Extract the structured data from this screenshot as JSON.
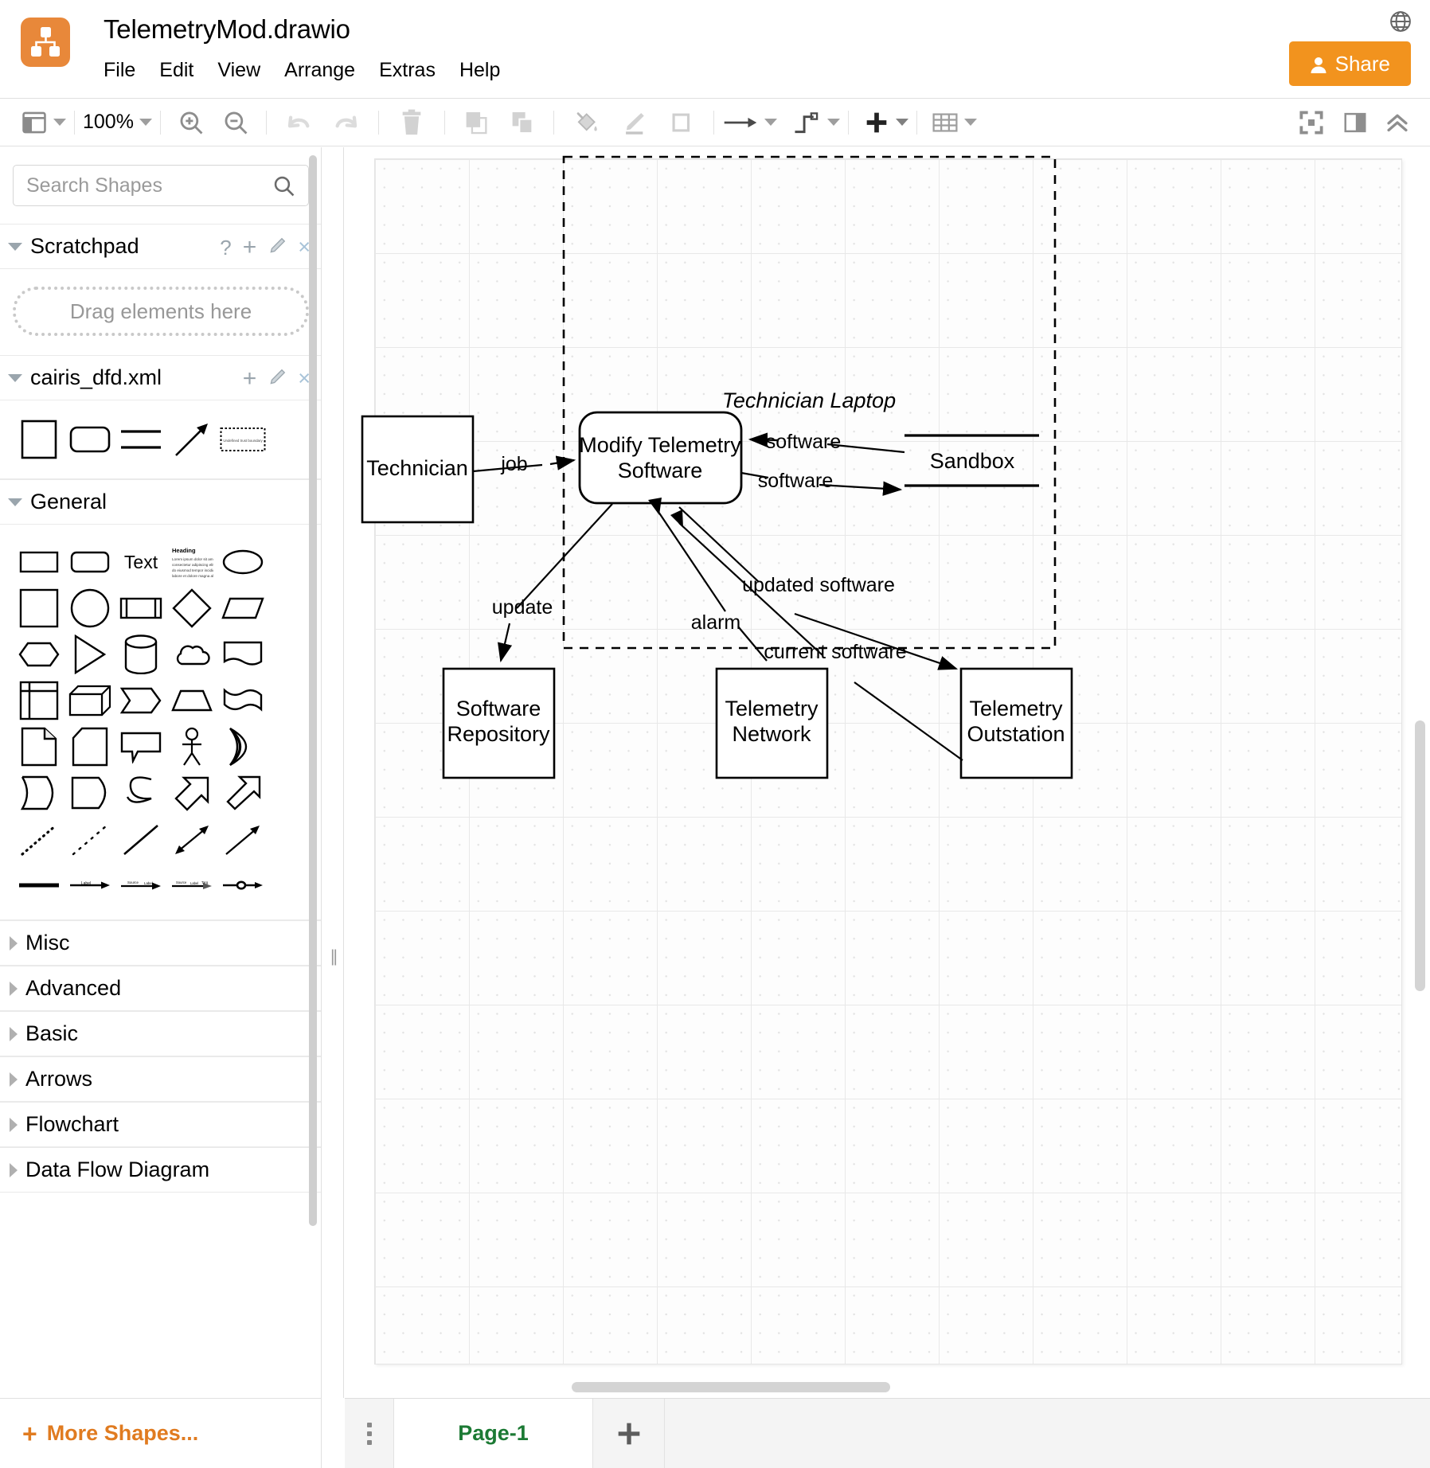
{
  "app": {
    "title": "TelemetryMod.drawio",
    "logo_icon": "drawio-logo-icon",
    "globe_icon": "globe-icon",
    "share_label": "Share",
    "share_icon": "person-icon"
  },
  "menubar": {
    "items": [
      {
        "label": "File"
      },
      {
        "label": "Edit"
      },
      {
        "label": "View"
      },
      {
        "label": "Arrange"
      },
      {
        "label": "Extras"
      },
      {
        "label": "Help"
      }
    ]
  },
  "toolbar": {
    "view_icon": "panel-layout-icon",
    "zoom_level": "100%",
    "zoom_in_icon": "zoom-in-icon",
    "zoom_out_icon": "zoom-out-icon",
    "undo_icon": "undo-icon",
    "redo_icon": "redo-icon",
    "delete_icon": "trash-icon",
    "to_front_icon": "bring-to-front-icon",
    "to_back_icon": "send-to-back-icon",
    "fill_icon": "fill-color-icon",
    "line_icon": "line-color-icon",
    "shadow_icon": "shadow-icon",
    "connection_icon": "arrow-connection-icon",
    "waypoints_icon": "waypoints-icon",
    "insert_icon": "plus-insert-icon",
    "table_icon": "table-icon",
    "fullscreen_icon": "fullscreen-icon",
    "format_panel_icon": "format-panel-icon",
    "collapse_icon": "chevron-up-double-icon"
  },
  "sidebar": {
    "search": {
      "placeholder": "Search Shapes",
      "value": "",
      "icon": "search-icon"
    },
    "scratchpad": {
      "title": "Scratchpad",
      "expanded": true,
      "help_label": "?",
      "add_label": "+",
      "edit_icon": "pencil-icon",
      "close_label": "×",
      "drop_hint": "Drag elements here"
    },
    "cairis": {
      "title": "cairis_dfd.xml",
      "expanded": true,
      "add_label": "+",
      "edit_icon": "pencil-icon",
      "close_label": "×",
      "shapes": [
        "entity-square-shape",
        "process-rounded-shape",
        "datastore-double-line-shape",
        "dataflow-arrow-shape",
        "trust-boundary-dashed-shape"
      ],
      "trust_boundary_text": "Undefined trust boundary"
    },
    "general": {
      "title": "General",
      "expanded": true,
      "shapes": [
        "rectangle-shape",
        "rounded-rectangle-shape",
        "text-shape",
        "textbox-heading-shape",
        "ellipse-shape",
        "square-shape",
        "circle-shape",
        "process-bar-shape",
        "diamond-shape",
        "parallelogram-shape",
        "hexagon-shape",
        "triangle-shape",
        "cylinder-shape",
        "cloud-shape",
        "document-shape",
        "internal-storage-shape",
        "cube-shape",
        "step-shape",
        "trapezoid-shape",
        "tape-shape",
        "note-shape",
        "card-shape",
        "callout-shape",
        "actor-shape",
        "or-shape",
        "data-storage-shape",
        "delay-shape",
        "s-curve-shape",
        "double-arrow-shape",
        "block-arrow-shape",
        "dotted-line-shape",
        "dashed-line-shape",
        "solid-line-shape",
        "bidirectional-arrow-shape",
        "directional-arrow-shape",
        "thick-line-shape",
        "labeled-arrow-shape",
        "source-target-arrow-shape",
        "dashed-labeled-arrow-shape",
        "circle-edge-arrow-shape"
      ],
      "shape_labels": {
        "text": "Text",
        "heading": "Heading",
        "body": "Lorem ipsum dolor sit amet, consectetur adipiscing elit, sed do eiusmod tempor incididunt ut labore et dolore magna aliqua."
      }
    },
    "collapsed_sections": [
      {
        "title": "Misc"
      },
      {
        "title": "Advanced"
      },
      {
        "title": "Basic"
      },
      {
        "title": "Arrows"
      },
      {
        "title": "Flowchart"
      },
      {
        "title": "Data Flow Diagram"
      }
    ],
    "footer": {
      "more_shapes_label": "More Shapes...",
      "plus_label": "+"
    }
  },
  "footer": {
    "menu_icon": "page-menu-icon",
    "pages": [
      {
        "label": "Page-1",
        "active": true
      }
    ],
    "add_page_label": "+",
    "add_page_icon": "plus-icon"
  },
  "diagram": {
    "trust_boundary": {
      "label": "Technician Laptop",
      "style": "dashed"
    },
    "nodes": [
      {
        "id": "technician",
        "label": "Technician",
        "type": "entity"
      },
      {
        "id": "modify",
        "label_line1": "Modify Telemetry",
        "label_line2": "Software",
        "type": "process"
      },
      {
        "id": "sandbox",
        "label": "Sandbox",
        "type": "datastore"
      },
      {
        "id": "repo",
        "label_line1": "Software",
        "label_line2": "Repository",
        "type": "entity"
      },
      {
        "id": "network",
        "label_line1": "Telemetry",
        "label_line2": "Network",
        "type": "entity"
      },
      {
        "id": "outstation",
        "label_line1": "Telemetry",
        "label_line2": "Outstation",
        "type": "entity"
      }
    ],
    "flows": [
      {
        "from": "technician",
        "to": "modify",
        "label": "job"
      },
      {
        "from": "sandbox",
        "to": "modify",
        "label": "software"
      },
      {
        "from": "modify",
        "to": "sandbox",
        "label": "software"
      },
      {
        "from": "modify",
        "to": "repo",
        "label": "update"
      },
      {
        "from": "network",
        "to": "modify",
        "label": "alarm"
      },
      {
        "from": "modify",
        "to": "outstation",
        "label": "updated software"
      },
      {
        "from": "outstation",
        "to": "modify",
        "label": "current software"
      }
    ]
  }
}
